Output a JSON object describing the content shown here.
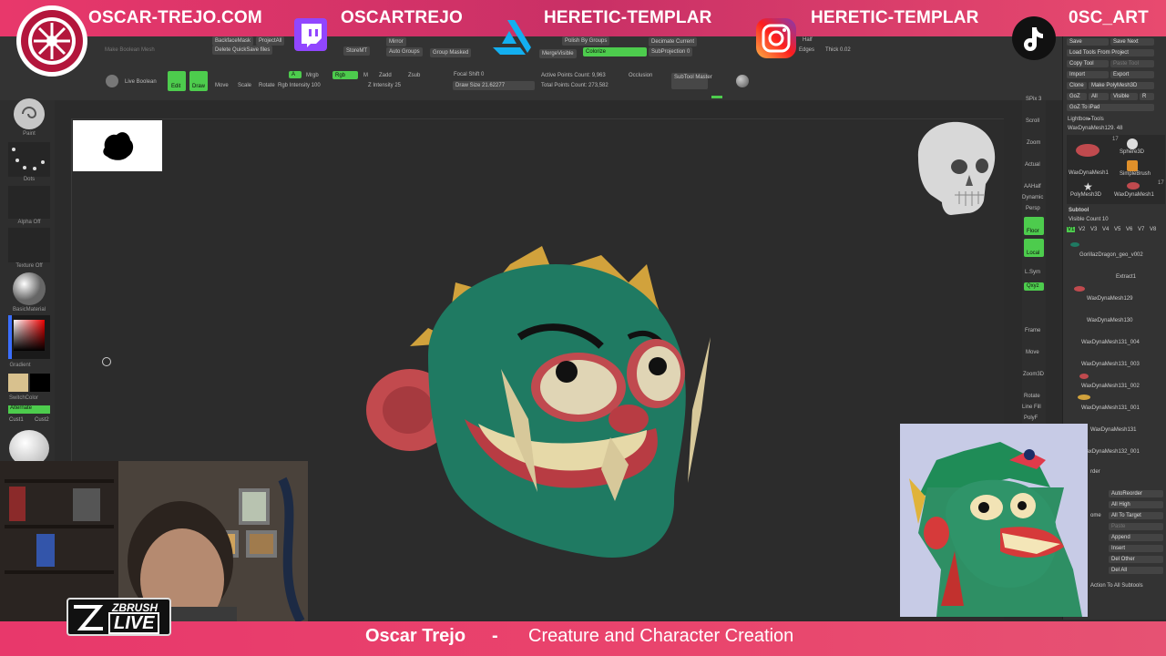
{
  "banner": {
    "site": "OSCAR-TREJO.COM",
    "twitch": "OSCARTREJO",
    "artstation": "HERETIC-TEMPLAR",
    "instagram": "HERETIC-TEMPLAR",
    "tiktok": "0SC_ART",
    "colors": {
      "banner": "#e8386b",
      "accent_green": "#4dcc4d"
    }
  },
  "toolbar": {
    "backface_mask": "BackfaceMask",
    "project_all": "ProjectAll",
    "delete_quicksave": "Delete QuickSave files",
    "make_boolean": "Make Boolean Mesh",
    "live_boolean": "Live Boolean",
    "edit": "Edit",
    "draw": "Draw",
    "move": "Move",
    "scale": "Scale",
    "rotate": "Rotate",
    "a_label": "A",
    "mrgb": "Mrgb",
    "rgb": "Rgb",
    "m_label": "M",
    "zadd": "Zadd",
    "zsub": "Zsub",
    "rgb_intensity": "Rgb Intensity 100",
    "z_intensity": "Z Intensity 25",
    "mirror": "Mirror",
    "auto_groups": "Auto Groups",
    "storemt": "StoreMT",
    "group_masked": "Group Masked",
    "polish_by_groups": "Polish By Groups",
    "colorize": "Colorize",
    "merge_visible": "MergeVisible",
    "decimate_current": "Decimate Current",
    "subprojection": "SubProjection 0",
    "focal_shift": "Focal Shift 0",
    "draw_size": "Draw Size 21.62277",
    "active_points": "Active Points Count: 9,963",
    "total_points": "Total Points Count: 273,582",
    "occlusion": "Occlusion",
    "subtool_master": "SubTool Master",
    "half": "Half",
    "edges": "Edges",
    "thick": "Thick 0.02"
  },
  "left_shelf": {
    "paint": "Paint",
    "dots": "Dots",
    "alpha_off": "Alpha Off",
    "texture_off": "Texture Off",
    "basic_material": "BasicMaterial",
    "gradient": "Gradient",
    "switch_color": "SwitchColor",
    "alternate": "Alternate",
    "cust1": "Cust1",
    "cust2": "Cust2"
  },
  "right_shelf": {
    "spix": "SPix 3",
    "scroll": "Scroll",
    "zoom": "Zoom",
    "actual": "Actual",
    "aahalf": "AAHalf",
    "dynamic": "Dynamic",
    "persp": "Persp",
    "floor": "Floor",
    "local": "Local",
    "lsym": "L.Sym",
    "qxyz": "Qxyz",
    "frame": "Frame",
    "move": "Move",
    "zoom3d": "Zoom3D",
    "rotate": "Rotate",
    "line_fill": "Line Fill",
    "polyf": "PolyF"
  },
  "right_panel": {
    "save": "Save",
    "save_next": "Save Next",
    "load_tools": "Load Tools From Project",
    "copy_tool": "Copy Tool",
    "paste_tool": "Paste Tool",
    "import": "Import",
    "export": "Export",
    "clone": "Clone",
    "make_polymesh": "Make PolyMesh3D",
    "goz": "GoZ",
    "all": "All",
    "visible": "Visible",
    "r": "R",
    "goz_ipad": "GoZ To iPad",
    "lightbox_tools": "Lightbox▸Tools",
    "current_tool": "WaxDynaMesh129. 48",
    "tool1": "WaxDynaMesh1",
    "tool2": "Sphere3D",
    "tool3": "SimpleBrush",
    "tool4": "PolyMesh3D",
    "tool5": "WaxDynaMesh1",
    "count17a": "17",
    "count17b": "17",
    "subtool": "Subtool",
    "visible_count": "Visible Count 10",
    "v_tabs": [
      "V1",
      "V2",
      "V3",
      "V4",
      "V5",
      "V6",
      "V7",
      "V8"
    ],
    "subtools": [
      "GorillazDragon_geo_v002",
      "Extract1",
      "WaxDynaMesh129",
      "WaxDynaMesh130",
      "WaxDynaMesh131_004",
      "WaxDynaMesh131_003",
      "WaxDynaMesh131_002",
      "WaxDynaMesh131_001",
      "WaxDynaMesh131",
      "WaxDynaMesh132_001"
    ],
    "auto_reorder": "AutoReorder",
    "all_high": "All High",
    "all_to_target": "All To Target",
    "paste": "Paste",
    "append": "Append",
    "insert": "Insert",
    "del_other": "Del Other",
    "del_all": "Del All",
    "action_all": "Action To All Subtools",
    "order": "rder",
    "ome": "ome"
  },
  "zbrush_live": {
    "top": "ZBRUSH",
    "live": "LIVE"
  },
  "bottom": {
    "name": "Oscar Trejo",
    "dash": "-",
    "desc": "Creature and Character Creation"
  }
}
